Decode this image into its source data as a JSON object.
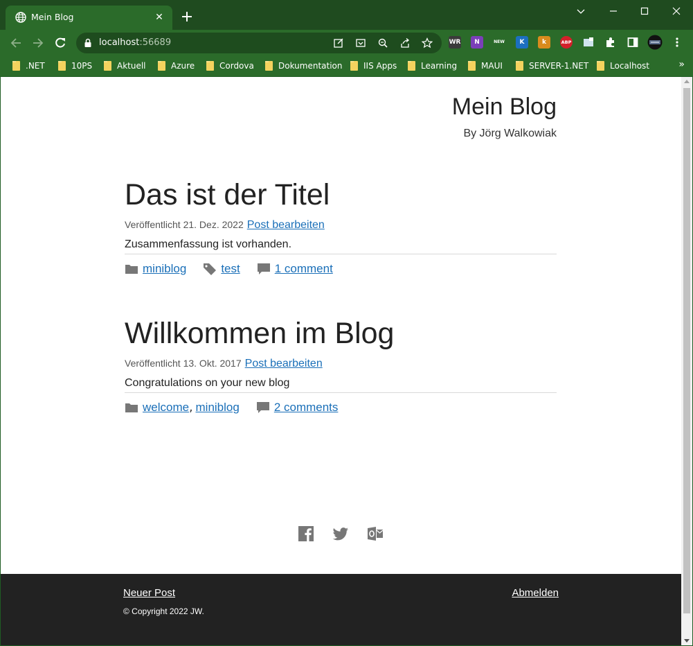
{
  "browser": {
    "tab": {
      "title": "Mein Blog",
      "favicon": "globe-icon"
    },
    "address": {
      "host": "localhost",
      "port": ":56689"
    },
    "bookmarks": [
      ".NET",
      "10PS",
      "Aktuell",
      "Azure",
      "Cordova",
      "Dokumentation",
      "IIS Apps",
      "Learning",
      "MAUI",
      "SERVER-1.NET",
      "Localhost"
    ],
    "bookmarks_overflow": "»",
    "extensions": [
      {
        "label": "WR",
        "color": "#3b3b3b"
      },
      {
        "label": "N",
        "color": "#7b3fb8"
      },
      {
        "label": "NEW",
        "color": "#2b6b2a"
      },
      {
        "label": "K",
        "color": "#1c6fbf"
      },
      {
        "label": "k",
        "color": "#d98b1d"
      },
      {
        "label": "ABP",
        "color": "#d4202a"
      }
    ]
  },
  "site": {
    "title": "Mein Blog",
    "byline": "By Jörg Walkowiak"
  },
  "posts": [
    {
      "title": "Das ist der Titel",
      "date": "Veröffentlicht 21. Dez. 2022",
      "edit_label": "Post bearbeiten",
      "excerpt": "Zusammenfassung ist vorhanden.",
      "categories": [
        "miniblog"
      ],
      "tags": [
        "test"
      ],
      "comments": "1 comment"
    },
    {
      "title": "Willkommen im Blog",
      "date": "Veröffentlicht 13. Okt. 2017",
      "edit_label": "Post bearbeiten",
      "excerpt": "Congratulations on your new blog",
      "categories": [
        "welcome",
        "miniblog"
      ],
      "comments": "2 comments"
    }
  ],
  "social": [
    "facebook-icon",
    "twitter-icon",
    "outlook-icon"
  ],
  "footer": {
    "new_post": "Neuer Post",
    "logout": "Abmelden",
    "copyright": "© Copyright 2022 JW."
  }
}
